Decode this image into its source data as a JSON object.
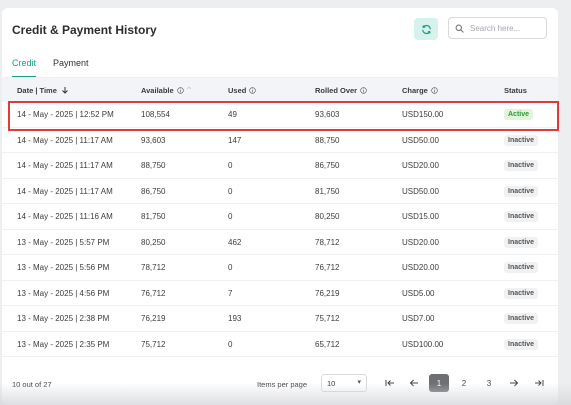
{
  "header": {
    "title": "Credit & Payment History",
    "refresh_icon": "refresh-icon",
    "search": {
      "placeholder": "Search here...",
      "value": ""
    }
  },
  "tabs": [
    {
      "label": "Credit",
      "active": true
    },
    {
      "label": "Payment",
      "active": false
    }
  ],
  "table": {
    "columns": {
      "date": "Date | Time",
      "available": "Available",
      "used": "Used",
      "rolled": "Rolled Over",
      "charge": "Charge",
      "status": "Status"
    },
    "rows": [
      {
        "date": "14 - May - 2025 | 12:52 PM",
        "available": "108,554",
        "used": "49",
        "rolled": "93,603",
        "charge": "USD150.00",
        "status": "Active"
      },
      {
        "date": "14 - May - 2025 | 11:17 AM",
        "available": "93,603",
        "used": "147",
        "rolled": "88,750",
        "charge": "USD50.00",
        "status": "Inactive"
      },
      {
        "date": "14 - May - 2025 | 11:17 AM",
        "available": "88,750",
        "used": "0",
        "rolled": "86,750",
        "charge": "USD20.00",
        "status": "Inactive"
      },
      {
        "date": "14 - May - 2025 | 11:17 AM",
        "available": "86,750",
        "used": "0",
        "rolled": "81,750",
        "charge": "USD50.00",
        "status": "Inactive"
      },
      {
        "date": "14 - May - 2025 | 11:16 AM",
        "available": "81,750",
        "used": "0",
        "rolled": "80,250",
        "charge": "USD15.00",
        "status": "Inactive"
      },
      {
        "date": "13 - May - 2025 | 5:57 PM",
        "available": "80,250",
        "used": "462",
        "rolled": "78,712",
        "charge": "USD20.00",
        "status": "Inactive"
      },
      {
        "date": "13 - May - 2025 | 5:56 PM",
        "available": "78,712",
        "used": "0",
        "rolled": "76,712",
        "charge": "USD20.00",
        "status": "Inactive"
      },
      {
        "date": "13 - May - 2025 | 4:56 PM",
        "available": "76,712",
        "used": "7",
        "rolled": "76,219",
        "charge": "USD5.00",
        "status": "Inactive"
      },
      {
        "date": "13 - May - 2025 | 2:38 PM",
        "available": "76,219",
        "used": "193",
        "rolled": "75,712",
        "charge": "USD7.00",
        "status": "Inactive"
      },
      {
        "date": "13 - May - 2025 | 2:35 PM",
        "available": "75,712",
        "used": "0",
        "rolled": "65,712",
        "charge": "USD100.00",
        "status": "Inactive"
      }
    ]
  },
  "footer": {
    "count": "10 out of 27",
    "items_per_page_label": "Items per page",
    "items_per_page": "10",
    "pages": [
      "1",
      "2",
      "3"
    ],
    "current_page": "1"
  },
  "colors": {
    "accent": "#16a085",
    "highlight": "#e0393e",
    "active_badge": "#2c9a3a"
  }
}
